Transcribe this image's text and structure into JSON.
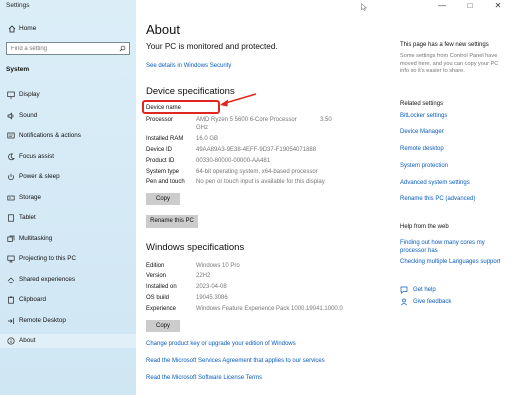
{
  "app_title": "Settings",
  "sidebar": {
    "home_label": "Home",
    "search_placeholder": "Find a setting",
    "section_title": "System",
    "items": [
      {
        "label": "Display"
      },
      {
        "label": "Sound"
      },
      {
        "label": "Notifications & actions"
      },
      {
        "label": "Focus assist"
      },
      {
        "label": "Power & sleep"
      },
      {
        "label": "Storage"
      },
      {
        "label": "Tablet"
      },
      {
        "label": "Multitasking"
      },
      {
        "label": "Projecting to this PC"
      },
      {
        "label": "Shared experiences"
      },
      {
        "label": "Clipboard"
      },
      {
        "label": "Remote Desktop"
      },
      {
        "label": "About"
      }
    ]
  },
  "window_controls": {
    "minimize": "—",
    "maximize": "□",
    "close": "✕"
  },
  "main": {
    "title": "About",
    "protected_text": "Your PC is monitored and protected.",
    "security_link": "See details in Windows Security",
    "device_specs_title": "Device specifications",
    "device_specs": [
      {
        "label": "Device name",
        "value": ""
      },
      {
        "label": "Processor",
        "value": "AMD Ryzen 5 5600 6-Core Processor",
        "value2": "3.50",
        "value3": "GHz"
      },
      {
        "label": "Installed RAM",
        "value": "16.0 GB"
      },
      {
        "label": "Device ID",
        "value": "49AA89A3-9E38-4EFF-9D37-F19054071888"
      },
      {
        "label": "Product ID",
        "value": "00330-80000-00000-AA481"
      },
      {
        "label": "System type",
        "value": "64-bit operating system, x64-based processor"
      },
      {
        "label": "Pen and touch",
        "value": "No pen or touch input is available for this display"
      }
    ],
    "copy_button": "Copy",
    "rename_button": "Rename this PC",
    "windows_specs_title": "Windows specifications",
    "windows_specs": [
      {
        "label": "Edition",
        "value": "Windows 10 Pro"
      },
      {
        "label": "Version",
        "value": "22H2"
      },
      {
        "label": "Installed on",
        "value": "2023-04-08"
      },
      {
        "label": "OS build",
        "value": "19045.3086"
      },
      {
        "label": "Experience",
        "value": "Windows Feature Experience Pack 1000.19041.1000.0"
      }
    ],
    "copy_button2": "Copy",
    "links": [
      "Change product key or upgrade your edition of Windows",
      "Read the Microsoft Services Agreement that applies to our services",
      "Read the Microsoft Software License Terms"
    ]
  },
  "right_panel": {
    "new_settings_title": "This page has a few new settings",
    "new_settings_desc": "Some settings from Control Panel have moved here, and you can copy your PC info so it's easier to share.",
    "related_title": "Related settings",
    "related_links": [
      "BitLocker settings",
      "Device Manager",
      "Remote desktop",
      "System protection",
      "Advanced system settings",
      "Rename this PC (advanced)"
    ],
    "help_title": "Help from the web",
    "help_links": [
      "Finding out how many cores my processor has",
      "Checking multiple Languages support"
    ],
    "get_help": "Get help",
    "give_feedback": "Give feedback"
  },
  "colors": {
    "accent": "#0a5cbd",
    "highlight": "#e0271f",
    "sidebar_bg": "#d4e9f5"
  }
}
